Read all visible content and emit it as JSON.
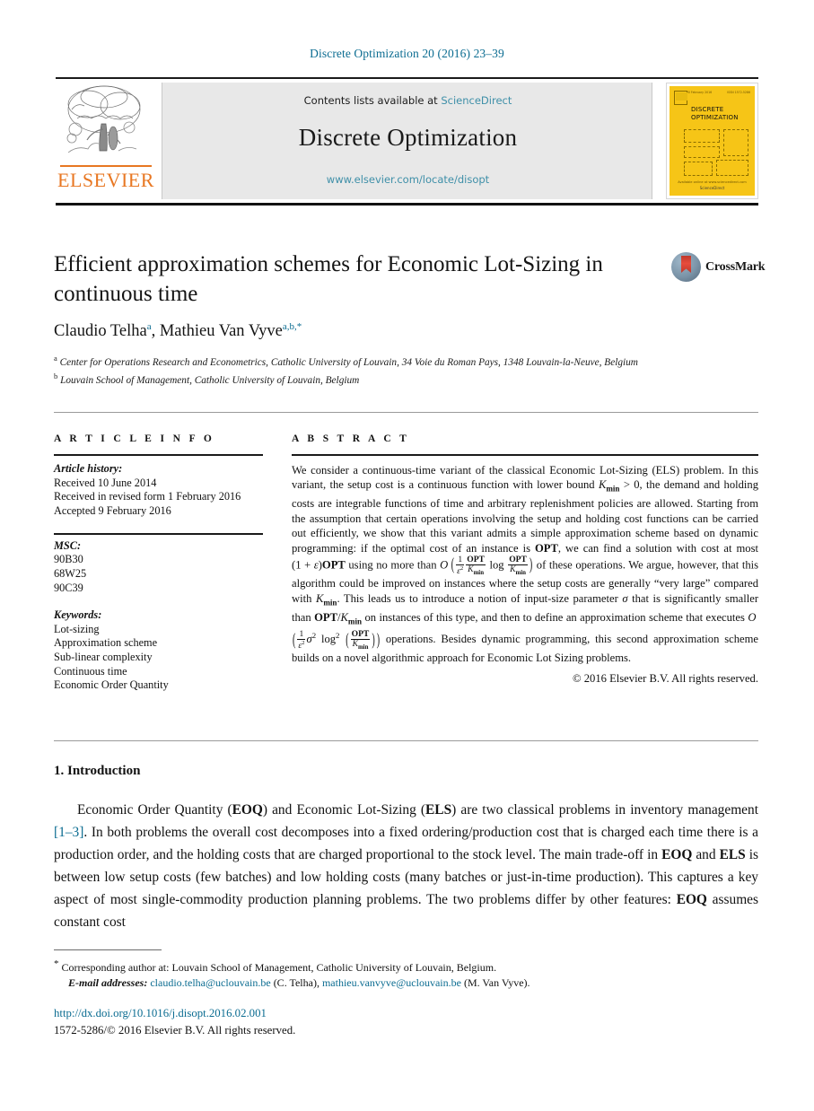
{
  "running_head": "Discrete Optimization 20 (2016) 23–39",
  "masthead": {
    "contents_prefix": "Contents lists available at ",
    "sciencedirect": "ScienceDirect",
    "journal_name": "Discrete Optimization",
    "journal_url": "www.elsevier.com/locate/disopt",
    "publisher_wordmark": "ELSEVIER",
    "publisher_logo_icon": "elsevier-tree-icon"
  },
  "cover": {
    "volume_line": "Volume 20   February 2016",
    "issn_line": "ISSN 1572-5286",
    "title_line1": "DISCRETE",
    "title_line2": "OPTIMIZATION",
    "foot_line": "Available online at www.sciencedirect.com",
    "foot_brand": "ScienceDirect"
  },
  "article": {
    "title": "Efficient approximation schemes for Economic Lot-Sizing in continuous time",
    "crossmark_label": "CrossMark",
    "crossmark_icon": "crossmark-badge-icon",
    "authors_html": "Claudio Telha<sup>a</sup>, Mathieu Van Vyve<sup>a,b,</sup><sup>*</sup>",
    "affiliation_a": "Center for Operations Research and Econometrics, Catholic University of Louvain, 34 Voie du Roman Pays, 1348 Louvain-la-Neuve, Belgium",
    "affiliation_b": "Louvain School of Management, Catholic University of Louvain, Belgium"
  },
  "info": {
    "heading": "A R T I C L E    I N F O",
    "history_label": "Article history:",
    "history": [
      "Received 10 June 2014",
      "Received in revised form 1 February 2016",
      "Accepted 9 February 2016"
    ],
    "msc_label": "MSC:",
    "msc": [
      "90B30",
      "68W25",
      "90C39"
    ],
    "keywords_label": "Keywords:",
    "keywords": [
      "Lot-sizing",
      "Approximation scheme",
      "Sub-linear complexity",
      "Continuous time",
      "Economic Order Quantity"
    ]
  },
  "abstract": {
    "heading": "A B S T R A C T",
    "copyright": "© 2016 Elsevier B.V. All rights reserved."
  },
  "introduction": {
    "heading": "1. Introduction"
  },
  "footnotes": {
    "corresponding": "Corresponding author at: Louvain School of Management, Catholic University of Louvain, Belgium.",
    "email_label": "E-mail addresses:",
    "email1": "claudio.telha@uclouvain.be",
    "email1_who": "(C. Telha),",
    "email2": "mathieu.vanvyve@uclouvain.be",
    "email2_who": "(M. Van Vyve)."
  },
  "footer": {
    "doi": "http://dx.doi.org/10.1016/j.disopt.2016.02.001",
    "issn_copyright": "1572-5286/© 2016 Elsevier B.V. All rights reserved."
  },
  "colors": {
    "link": "#0b6c91",
    "sciencedirect": "#3e8fa8",
    "elsevier_orange": "#e87722",
    "cover_yellow": "#f6c517",
    "crossmark_red": "#c0392b"
  }
}
